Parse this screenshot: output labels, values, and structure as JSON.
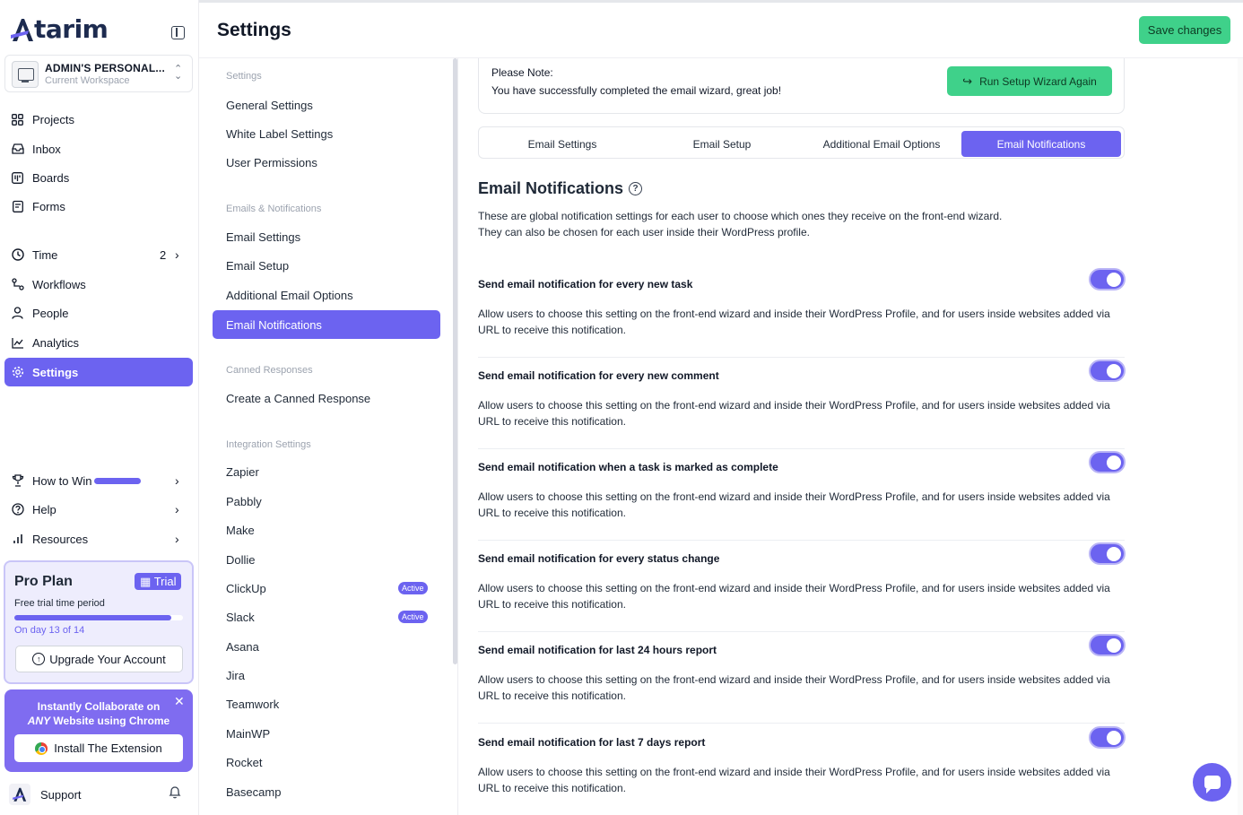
{
  "brand": {
    "name": "tarim",
    "accent": "#6c63f0",
    "green": "#3fd18a"
  },
  "workspace": {
    "name": "ADMIN'S PERSONAL...",
    "sub": "Current Workspace"
  },
  "nav": {
    "projects": "Projects",
    "inbox": "Inbox",
    "boards": "Boards",
    "forms": "Forms",
    "time": "Time",
    "time_count": "2",
    "workflows": "Workflows",
    "people": "People",
    "analytics": "Analytics",
    "settings": "Settings",
    "how_to_win": "How to Win",
    "help": "Help",
    "resources": "Resources"
  },
  "plan": {
    "title": "Pro Plan",
    "badge": "Trial",
    "subtitle": "Free trial time period",
    "progress": 0.93,
    "day_text": "On day 13 of 14",
    "upgrade_label": "Upgrade Your Account"
  },
  "promo": {
    "line1": "Instantly Collaborate on",
    "line2_em": "ANY",
    "line2_rest": " Website using Chrome",
    "button": "Install The Extension"
  },
  "support": {
    "label": "Support"
  },
  "header": {
    "title": "Settings",
    "save_label": "Save changes"
  },
  "subnav": {
    "settings_head": "Settings",
    "general": "General Settings",
    "white_label": "White Label Settings",
    "user_permissions": "User Permissions",
    "emails_head": "Emails & Notifications",
    "email_settings": "Email Settings",
    "email_setup": "Email Setup",
    "additional_email": "Additional Email Options",
    "email_notifications": "Email Notifications",
    "canned_head": "Canned Responses",
    "create_canned": "Create a Canned Response",
    "integration_head": "Integration Settings",
    "integrations": [
      {
        "label": "Zapier",
        "badge": ""
      },
      {
        "label": "Pabbly",
        "badge": ""
      },
      {
        "label": "Make",
        "badge": ""
      },
      {
        "label": "Dollie",
        "badge": ""
      },
      {
        "label": "ClickUp",
        "badge": "Active"
      },
      {
        "label": "Slack",
        "badge": "Active"
      },
      {
        "label": "Asana",
        "badge": ""
      },
      {
        "label": "Jira",
        "badge": ""
      },
      {
        "label": "Teamwork",
        "badge": ""
      },
      {
        "label": "MainWP",
        "badge": ""
      },
      {
        "label": "Rocket",
        "badge": ""
      },
      {
        "label": "Basecamp",
        "badge": ""
      }
    ]
  },
  "note": {
    "title": "Please Note:",
    "text": "You have successfully completed the email wizard, great job!",
    "wizard_label": "Run Setup Wizard Again"
  },
  "tabs": [
    {
      "label": "Email Settings",
      "active": false
    },
    {
      "label": "Email Setup",
      "active": false
    },
    {
      "label": "Additional Email Options",
      "active": false
    },
    {
      "label": "Email Notifications",
      "active": true
    }
  ],
  "section": {
    "title": "Email Notifications",
    "desc_line1": "These are global notification settings for each user to choose which ones they receive on the front-end wizard.",
    "desc_line2": "They can also be chosen for each user inside their WordPress profile."
  },
  "notifications": [
    {
      "title": "Send email notification for every new task",
      "desc": "Allow users to choose this setting on the front-end wizard and inside their WordPress Profile, and for users inside websites added via URL to receive this notification.",
      "enabled": true
    },
    {
      "title": "Send email notification for every new comment",
      "desc": "Allow users to choose this setting on the front-end wizard and inside their WordPress Profile, and for users inside websites added via URL to receive this notification.",
      "enabled": true
    },
    {
      "title": "Send email notification when a task is marked as complete",
      "desc": "Allow users to choose this setting on the front-end wizard and inside their WordPress Profile, and for users inside websites added via URL to receive this notification.",
      "enabled": true
    },
    {
      "title": "Send email notification for every status change",
      "desc": "Allow users to choose this setting on the front-end wizard and inside their WordPress Profile, and for users inside websites added via URL to receive this notification.",
      "enabled": true
    },
    {
      "title": "Send email notification for last 24 hours report",
      "desc": "Allow users to choose this setting on the front-end wizard and inside their WordPress Profile, and for users inside websites added via URL to receive this notification.",
      "enabled": true
    },
    {
      "title": "Send email notification for last 7 days report",
      "desc": "Allow users to choose this setting on the front-end wizard and inside their WordPress Profile, and for users inside websites added via URL to receive this notification.",
      "enabled": true
    }
  ]
}
